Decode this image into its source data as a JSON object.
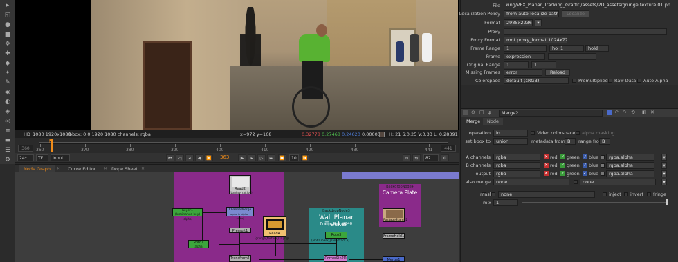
{
  "viewer": {
    "info_format": "HD_1080 1920x1080",
    "info_bbox": "bbox: 0 0 1920 1080 channels: rgba",
    "info_coords": "x=972 y=168",
    "info_r": "0.32778",
    "info_g": "0.27468",
    "info_b": "0.24620",
    "info_a": "0.00000",
    "info_hsvl": "H: 21 S:0.25 V:0.33  L: 0.28391"
  },
  "timeline": {
    "frame_left": "360",
    "frame_right": "441",
    "ticks": [
      "360",
      "370",
      "380",
      "390",
      "400",
      "410",
      "420",
      "430",
      "441"
    ],
    "current_marker": "363"
  },
  "transport": {
    "fps": "24*",
    "tf": "TF",
    "input": "Input",
    "current_frame": "363",
    "step": "10",
    "end_frame": "82"
  },
  "tabs": {
    "node_graph": "Node Graph",
    "curve_editor": "Curve Editor",
    "dope_sheet": "Dope Sheet"
  },
  "graph": {
    "read2": "Read2",
    "read2_sub": "(banksy_rat.jpg)",
    "keyer": "Keyer1 (luminance key)",
    "keyer_sub": "(alpha)",
    "channelmerge": "ChannelMerge",
    "channelmerge_sub": "(alpha in alpha → alpha)",
    "premult": "Premult1",
    "roto1": "Roto1",
    "roto1_sub": "(alpha)",
    "read4": "Read4",
    "read4_sub": "(grunge_texture_01.png)",
    "transform": "Transform1",
    "backdrop3_title": "BackdropNode3",
    "backdrop3_label": "Wall Planar Tracker",
    "backdrop3_frame": "Frame Ref: #340",
    "roto3": "Roto3",
    "roto3_sub": "(alpha mask_planartrack.a)",
    "cornerpin": "CornerPin2D",
    "backdrop4_title": "BackdropNode4",
    "backdrop4_label": "Camera Plate",
    "postagestamp": "PostageStamp2",
    "framehold": "FrameHold1",
    "merge_node": "Merge1"
  },
  "read_props": {
    "file_label": "File",
    "file_value": "king/VFX_Planar_Tracking_Graffiti/assets/2D_assets/grunge texture 01.png",
    "localization_label": "Localization Policy",
    "localization_value": "from auto-localize path",
    "localize_button": "Localize",
    "format_label": "Format",
    "format_value": "2985x2236",
    "proxy_label": "Proxy",
    "proxy_format_label": "Proxy Format",
    "proxy_format_value": "root.proxy_format 1024x778",
    "frame_range_label": "Frame Range",
    "frame_range_start": "1",
    "frame_range_before": "hold",
    "frame_range_end": "1",
    "frame_range_after": "hold",
    "frame_label": "Frame",
    "frame_value": "expression",
    "original_range_label": "Original Range",
    "original_range_start": "1",
    "original_range_end": "1",
    "missing_frames_label": "Missing Frames",
    "missing_frames_value": "error",
    "reload_button": "Reload",
    "colorspace_label": "Colorspace",
    "colorspace_value": "default (sRGB)",
    "premultiplied": "Premultiplied",
    "raw_data": "Raw Data",
    "auto_alpha": "Auto Alpha"
  },
  "merge_props": {
    "name": "Merge2",
    "tab_merge": "Merge",
    "tab_node": "Node",
    "operation_label": "operation",
    "operation_value": "in",
    "video_colorspace": "Video colorspace",
    "alpha_masking": "alpha masking",
    "set_bbox_label": "set bbox to",
    "set_bbox_value": "union",
    "metadata_from": "metadata from",
    "metadata_value": "B",
    "range_from": "range from",
    "range_value": "B",
    "a_channels_label": "A channels",
    "a_channels_value": "rgba",
    "b_channels_label": "B channels",
    "b_channels_value": "rgba",
    "output_label": "output",
    "output_value": "rgba",
    "also_merge_label": "also merge",
    "also_merge_value": "none",
    "also_merge_value2": "none",
    "red": "red",
    "green": "green",
    "blue": "blue",
    "alpha_channel": "rgba.alpha",
    "mask_label": "mask",
    "mask_value": "none",
    "inject": "inject",
    "invert": "invert",
    "fringe": "fringe",
    "mix_label": "mix",
    "mix_value": "1"
  },
  "colors": {
    "accent": "#f08c1a",
    "backdrop_purple": "#8a2a8a",
    "backdrop_teal": "#2a8a88",
    "node_green": "#3ca63c",
    "node_blue": "#7a8acf",
    "node_grey": "#b0b0b0"
  }
}
